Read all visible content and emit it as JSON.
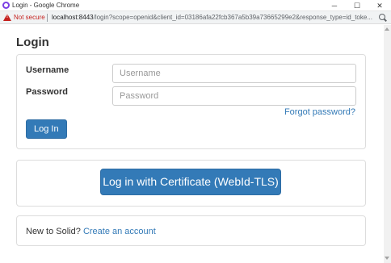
{
  "window": {
    "title": "Login - Google Chrome",
    "minimize": "─",
    "maximize": "☐",
    "close": "✕"
  },
  "addressbar": {
    "security_label": "Not secure",
    "url_host": "localhost:8443",
    "url_rest": "/login?scope=openid&client_id=03186afa22fcb367a5b39a73665299e2&response_type=id_toke..."
  },
  "page": {
    "heading": "Login"
  },
  "login_form": {
    "username_label": "Username",
    "username_placeholder": "Username",
    "username_value": "",
    "password_label": "Password",
    "password_placeholder": "Password",
    "password_value": "",
    "forgot_link": "Forgot password?",
    "submit_label": "Log In"
  },
  "certificate": {
    "button_label": "Log in with Certificate (WebId-TLS)"
  },
  "signup": {
    "prompt": "New to Solid?",
    "link": "Create an account"
  },
  "colors": {
    "primary": "#337ab7",
    "warning": "#c5221f",
    "app_icon": "#7b3fe4"
  }
}
